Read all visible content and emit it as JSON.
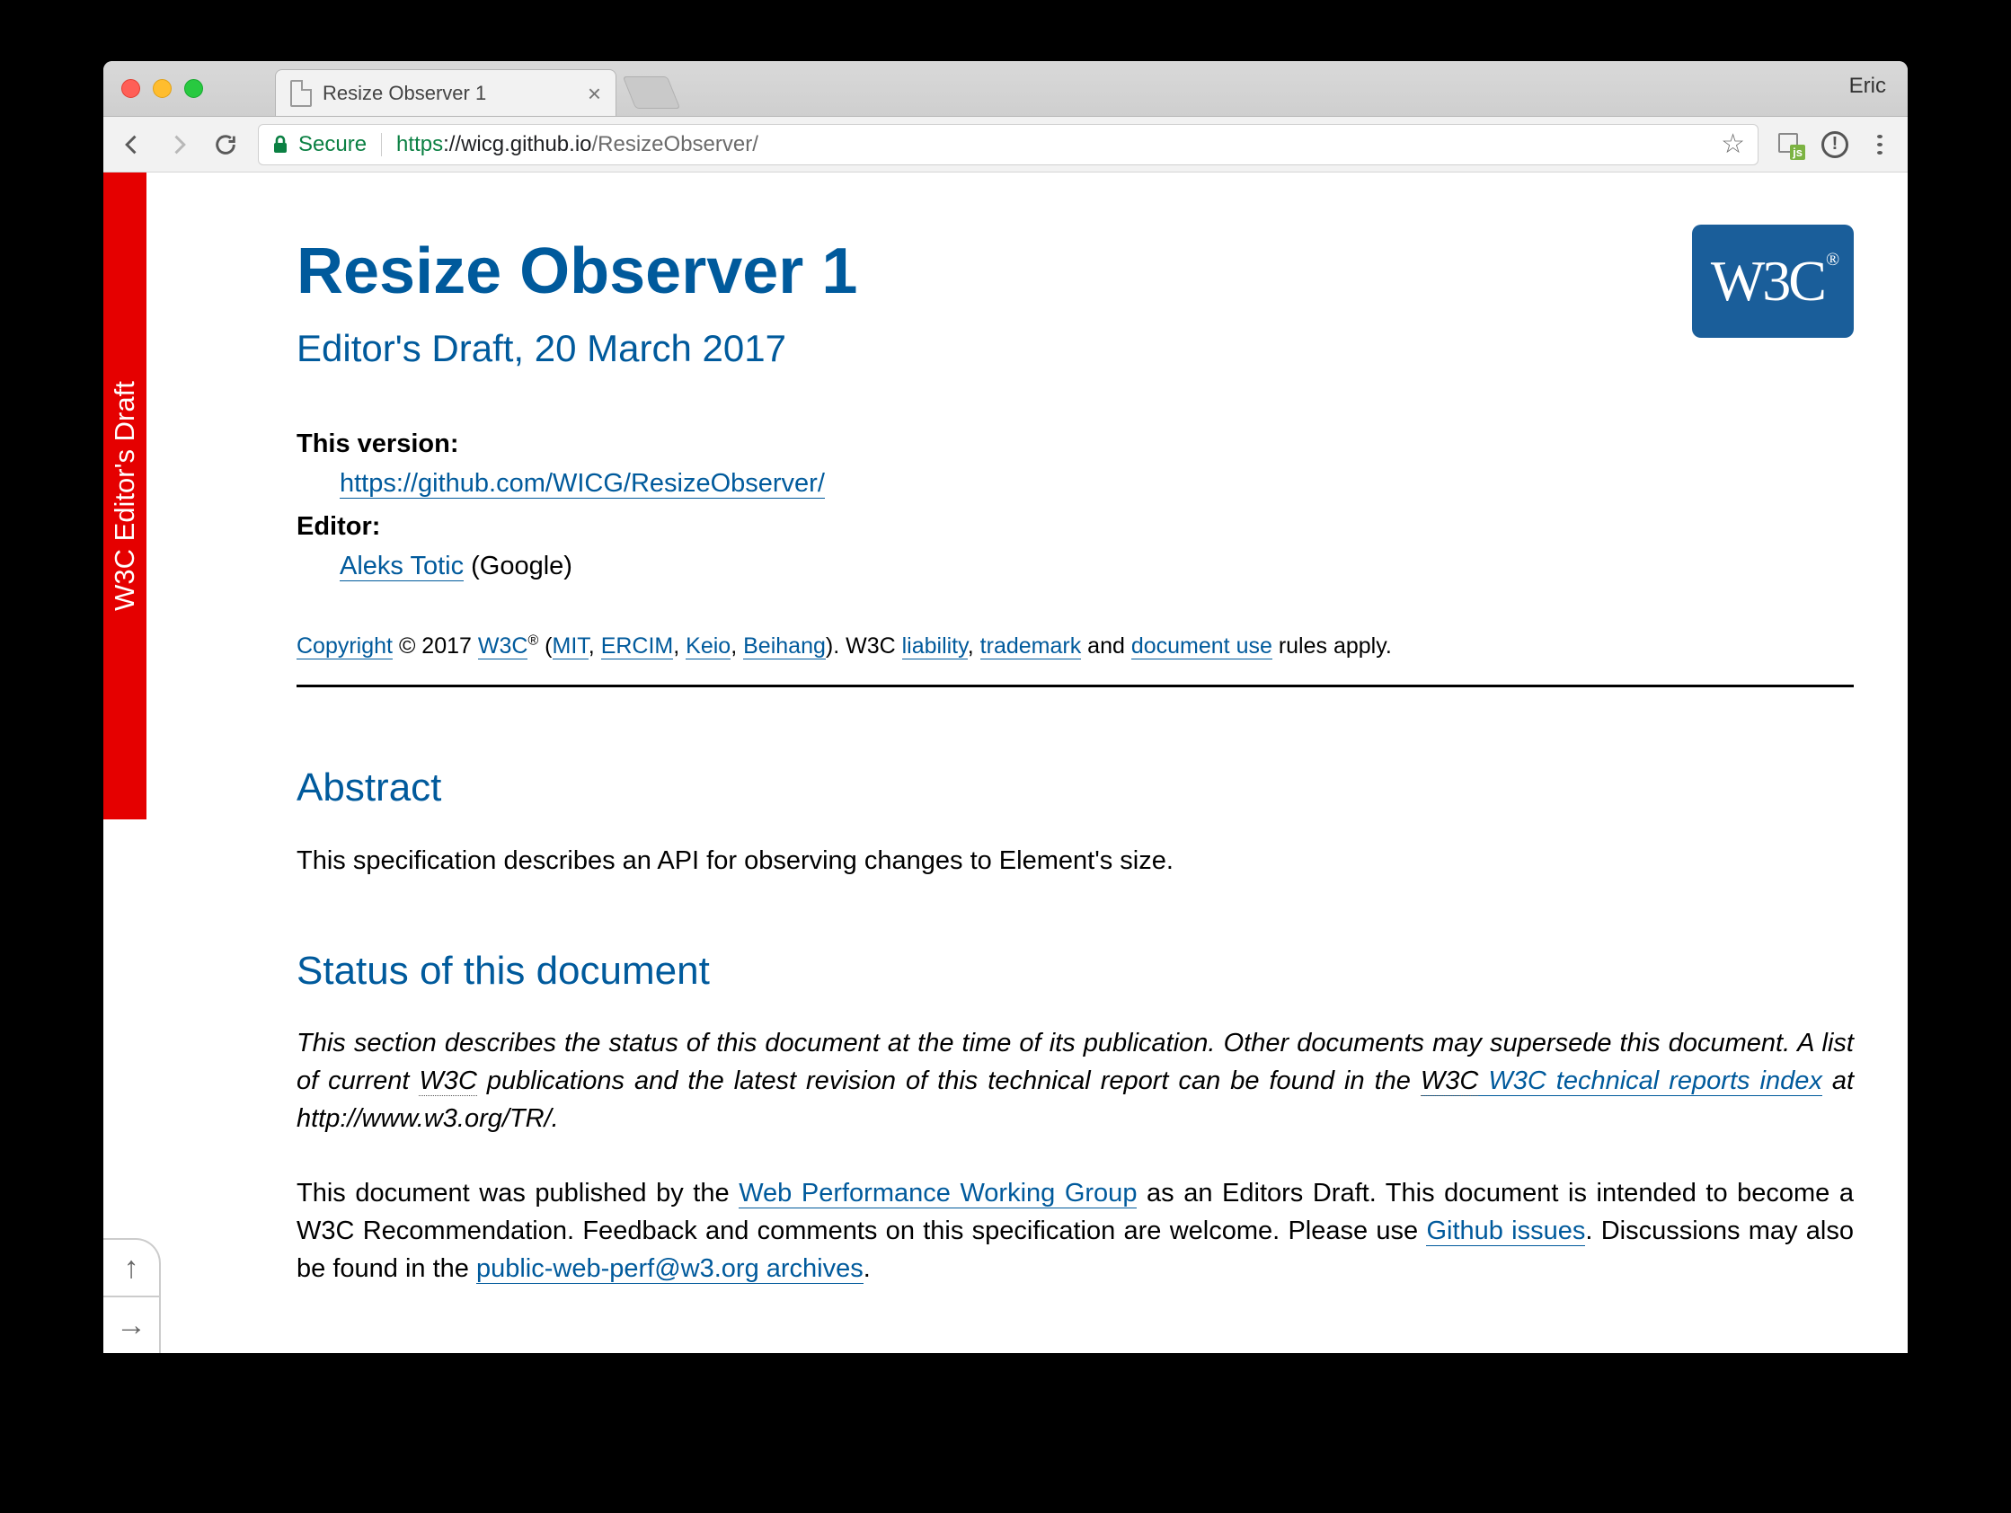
{
  "browser": {
    "profile_name": "Eric",
    "tab": {
      "title": "Resize Observer 1"
    },
    "omnibox": {
      "secure_label": "Secure",
      "protocol": "https",
      "host": "://wicg.github.io",
      "path": "/ResizeObserver/"
    }
  },
  "page": {
    "draft_banner": "W3C Editor's Draft",
    "title": "Resize Observer 1",
    "subtitle": "Editor's Draft, 20 March 2017",
    "w3c_logo_text": "W3C",
    "meta": {
      "this_version_label": "This version:",
      "this_version_url": "https://github.com/WICG/ResizeObserver/",
      "editor_label": "Editor:",
      "editor_name": "Aleks Totic",
      "editor_affiliation": " (Google)"
    },
    "copyright": {
      "word": "Copyright",
      "year": " © 2017 ",
      "w3c": "W3C",
      "reg": "®",
      "open": " (",
      "mit": "MIT",
      "c1": ", ",
      "ercim": "ERCIM",
      "c2": ", ",
      "keio": "Keio",
      "c3": ", ",
      "beihang": "Beihang",
      "close": "). W3C ",
      "liability": "liability",
      "c4": ", ",
      "trademark": "trademark",
      "and": " and ",
      "docuse": "document use",
      "tail": " rules apply."
    },
    "abstract": {
      "heading": "Abstract",
      "text": "This specification describes an API for observing changes to Element's size."
    },
    "status": {
      "heading": "Status of this document",
      "p1_a": "This section describes the status of this document at the time of its publication. Other documents may supersede this document. A list of current ",
      "p1_w3c": "W3C",
      "p1_b": " publications and the latest revision of this technical report can be found in the ",
      "p1_link": "W3C technical reports index",
      "p1_c": " at http://www.w3.org/TR/.",
      "p2_a": "This document was published by the ",
      "p2_link1": "Web Performance Working Group",
      "p2_b": " as an Editors Draft. This document is in­tended to become a W3C Recommendation. Feedback and comments on this specification are welcome. Please use ",
      "p2_link2": "Github issues",
      "p2_c": ". Discussions may also be found in the ",
      "p2_link3": "public-web-perf@w3.org archives",
      "p2_d": "."
    }
  }
}
